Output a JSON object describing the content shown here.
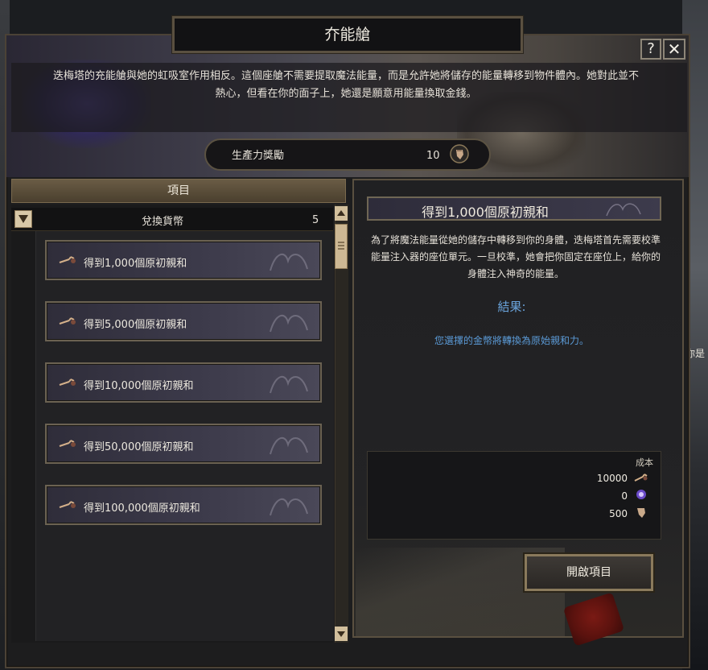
{
  "window": {
    "title": "夰能艙",
    "help_label": "?",
    "close_label": "✕",
    "description": "迭梅塔的充能艙與她的虹吸室作用相反。這個座艙不需要提取魔法能量，而是允許她將儲存的能量轉移到物件體內。她對此並不熱心，但看在你的面子上，她還是願意用能量換取金錢。",
    "productivity_label": "生產力獎勵",
    "productivity_value": "10",
    "background_side_text": "你是"
  },
  "left_panel": {
    "header": "項目",
    "category": {
      "label": "兌換貨幣",
      "count": "5"
    },
    "items": [
      {
        "label": "得到1,000個原初親和",
        "icon": "key-icon"
      },
      {
        "label": "得到5,000個原初親和",
        "icon": "key-icon"
      },
      {
        "label": "得到10,000個原初親和",
        "icon": "key-icon"
      },
      {
        "label": "得到50,000個原初親和",
        "icon": "key-icon"
      },
      {
        "label": "得到100,000個原初親和",
        "icon": "key-icon"
      }
    ]
  },
  "right_panel": {
    "title": "得到1,000個原初親和",
    "description": "為了將魔法能量從她的儲存中轉移到你的身體，迭梅塔首先需要校準能量注入器的座位單元。一旦校準，她會把你固定在座位上，給你的身體注入神奇的能量。",
    "result_heading": "結果:",
    "result_text": "您選擇的金幣將轉換為原始親和力。",
    "cost": {
      "title": "成本",
      "rows": [
        {
          "value": "10000",
          "icon": "key-icon"
        },
        {
          "value": "0",
          "icon": "purple-orb-icon"
        },
        {
          "value": "500",
          "icon": "productivity-fist-icon"
        }
      ]
    },
    "open_button": "開啟項目"
  },
  "colors": {
    "accent_gold": "#8a7858",
    "result_blue": "#6aa4dc",
    "item_purple": "#3c3a4a"
  }
}
